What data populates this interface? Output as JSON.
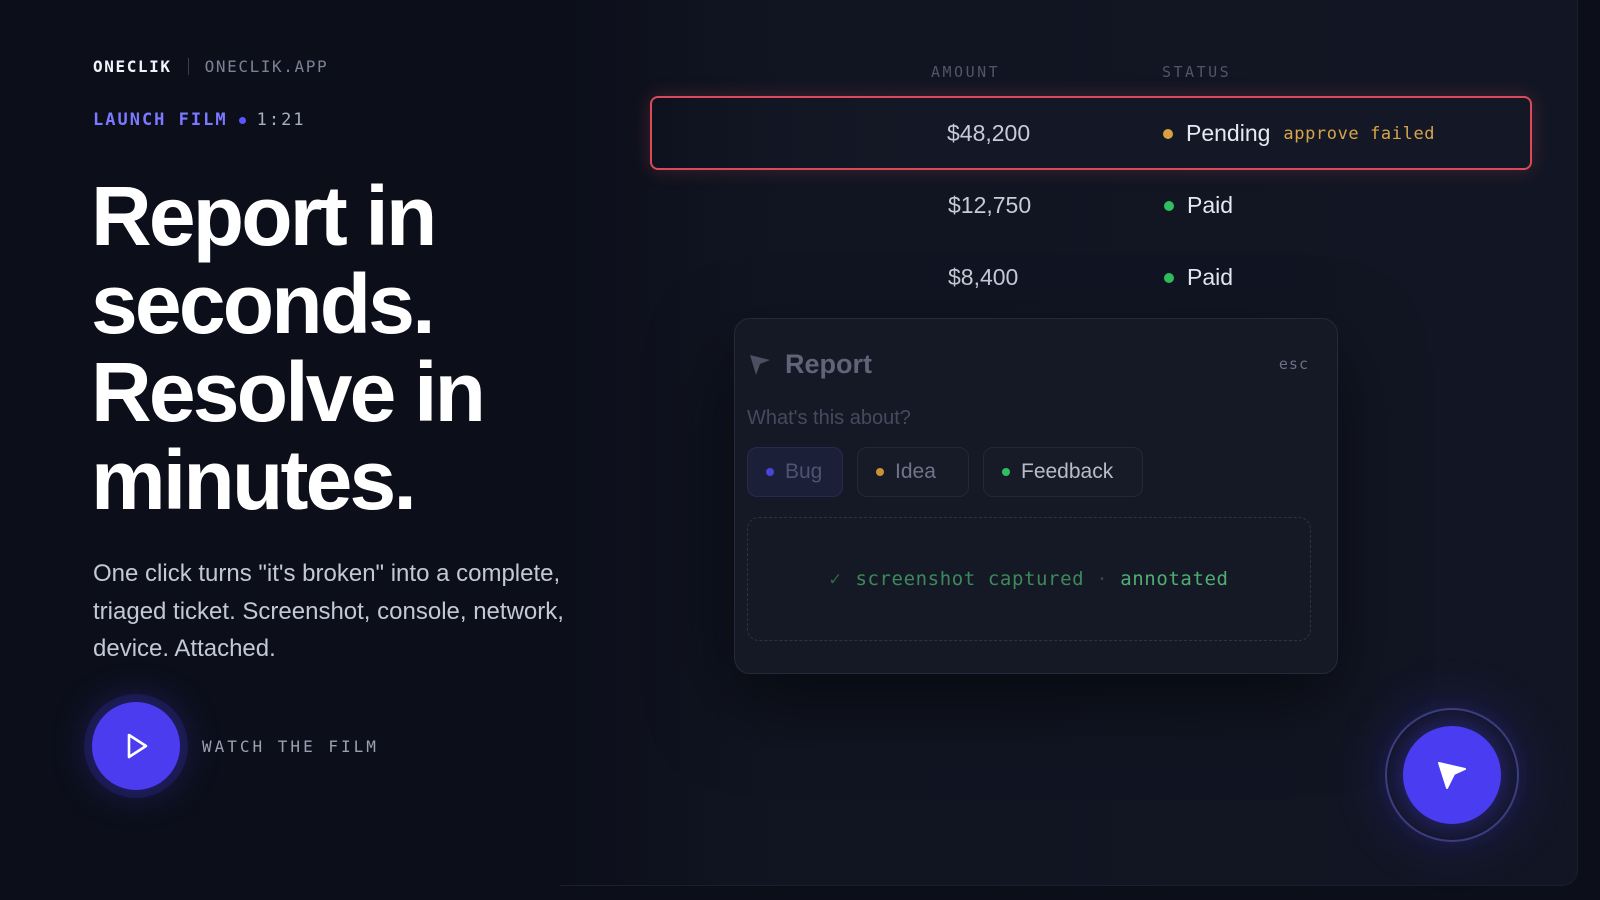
{
  "brand": {
    "name": "ONECLIK",
    "url": "ONECLIK.APP"
  },
  "eyebrow": {
    "label": "LAUNCH FILM",
    "duration": "1:21"
  },
  "hero": {
    "headline_lines": [
      "Report in",
      "seconds.",
      "Resolve in",
      "minutes."
    ],
    "lede": "One click turns \"it's broken\" into a complete, triaged ticket. Screenshot, console, network, device. Attached.",
    "watch_label": "WATCH THE FILM"
  },
  "table": {
    "headers": {
      "amount": "AMOUNT",
      "status": "STATUS"
    },
    "rows": [
      {
        "amount": "$48,200",
        "status": "Pending",
        "note": "approve failed",
        "status_color": "#d9a040",
        "selected": true
      },
      {
        "amount": "$12,750",
        "status": "Paid",
        "note": "",
        "status_color": "#2fbf60",
        "selected": false
      },
      {
        "amount": "$8,400",
        "status": "Paid",
        "note": "",
        "status_color": "#2fbf60",
        "selected": false
      }
    ]
  },
  "report_modal": {
    "title": "Report",
    "close_hint": "esc",
    "prompt": "What's this about?",
    "categories": [
      {
        "label": "Bug",
        "color": "#4a45d8"
      },
      {
        "label": "Idea",
        "color": "#c8913a"
      },
      {
        "label": "Feedback",
        "color": "#2fbf60"
      }
    ],
    "capture": {
      "check": "✓",
      "part1": "screenshot captured",
      "separator": "·",
      "part2": "annotated"
    }
  },
  "colors": {
    "accent": "#4b3cf0",
    "background": "#0c0f1a",
    "error_border": "#d94a5a",
    "pending": "#d9a040",
    "paid": "#2fbf60"
  },
  "icons": {
    "play": "play-icon",
    "report": "report-flag-icon",
    "fab": "report-pointer-icon"
  }
}
